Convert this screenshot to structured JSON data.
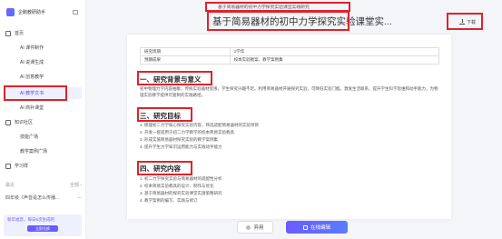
{
  "sidebar": {
    "brand": "企鹅教研助手",
    "items": [
      {
        "label": "首页",
        "type": "main",
        "active": false
      },
      {
        "label": "AI 课件制作",
        "type": "sub",
        "active": false
      },
      {
        "label": "AI 说课生成",
        "type": "sub",
        "active": false
      },
      {
        "label": "AI 创意教学",
        "type": "sub",
        "active": false
      },
      {
        "label": "AI 教学文书",
        "type": "sub",
        "active": true
      },
      {
        "label": "AI 商补课堂",
        "type": "sub",
        "active": false
      },
      {
        "label": "知识社区",
        "type": "main",
        "active": false
      },
      {
        "label": "技能广场",
        "type": "sub",
        "active": false
      },
      {
        "label": "教学案例广场",
        "type": "sub",
        "active": false
      },
      {
        "label": "学习样",
        "type": "main",
        "active": false
      }
    ],
    "recent_label": "最近",
    "recent_more": "全部 ›",
    "recent_item": "四年级《声音是怎么传播…",
    "recent_more_icon": "…",
    "promo_text": "新年福音，每日6次生成吧",
    "promo_button": "立即兑换"
  },
  "header": {
    "breadcrumb": "基于简易器材的初中力学探究实验课堂实践研究",
    "title": "基于简易器材的初中力学探究实验课堂实...",
    "download_label": "下载"
  },
  "document": {
    "meta_rows": [
      {
        "key": "研究周期",
        "value": "1学年"
      },
      {
        "key": "预期成果",
        "value": "校本实验教案、教学案例集"
      }
    ],
    "sections": [
      {
        "heading": "一、研究背景与意义",
        "paragraph": "初中物理力学内容抽象，传统实验器材受限，学生探究兴趣不足。利用简易器材开展探究实验，可降低实验门槛，激发生活联系，提升学生科学思维和动手能力，为物理实验教学提供可复制的实践路径。"
      },
      {
        "heading": "三、研究目标",
        "items": [
          "1. 梳理初二力学核心探究实验内容，筛选适配简易器材的实验项目",
          "2. 开发一套适用于初二力学教学的校本简易实验教具",
          "3. 形成实施简易器材探究实验的教学案例集",
          "4. 提升学生力学知识运用能力与实践动手能力"
        ]
      },
      {
        "heading": "四、研究内容",
        "items": [
          "1. 初二力学探究实验与简易器材的适配性分析",
          "2. 校本简易实验教具的设计、制作与优化",
          "3. 基于简易器材的探究实验课堂实施策略研究",
          "4. 教学案例的编写、实践与修订"
        ]
      }
    ]
  },
  "actions": {
    "discard_label": "弃用",
    "edit_label": "在线编辑"
  },
  "colors": {
    "accent": "#6a5cff",
    "highlight": "#e0222a"
  }
}
